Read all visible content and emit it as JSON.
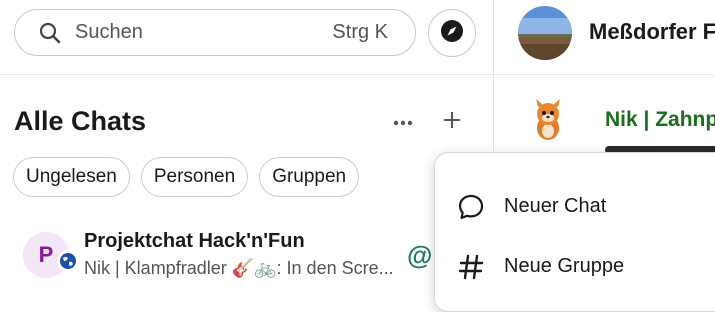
{
  "search": {
    "placeholder": "Suchen",
    "shortcut": "Strg K"
  },
  "sidebar": {
    "title": "Alle Chats",
    "filters": [
      {
        "label": "Ungelesen"
      },
      {
        "label": "Personen"
      },
      {
        "label": "Gruppen"
      }
    ]
  },
  "chats": [
    {
      "avatar_letter": "P",
      "name": "Projektchat Hack'n'Fun",
      "preview": "Nik | Klampfradler 🎸🚲: In den Scre...",
      "mention_symbol": "@"
    }
  ],
  "room": {
    "title": "Meßdorfer F"
  },
  "message": {
    "sender": "Nik | Zahnp"
  },
  "menu": {
    "items": [
      {
        "label": "Neuer Chat",
        "icon": "chat-bubble-icon"
      },
      {
        "label": "Neue Gruppe",
        "icon": "hash-icon"
      }
    ]
  },
  "colors": {
    "accent_green": "#1a7f5a",
    "sender_green": "#1b6e1b",
    "avatar_purple": "#8a1a9b",
    "globe_blue": "#1d4fa8"
  }
}
